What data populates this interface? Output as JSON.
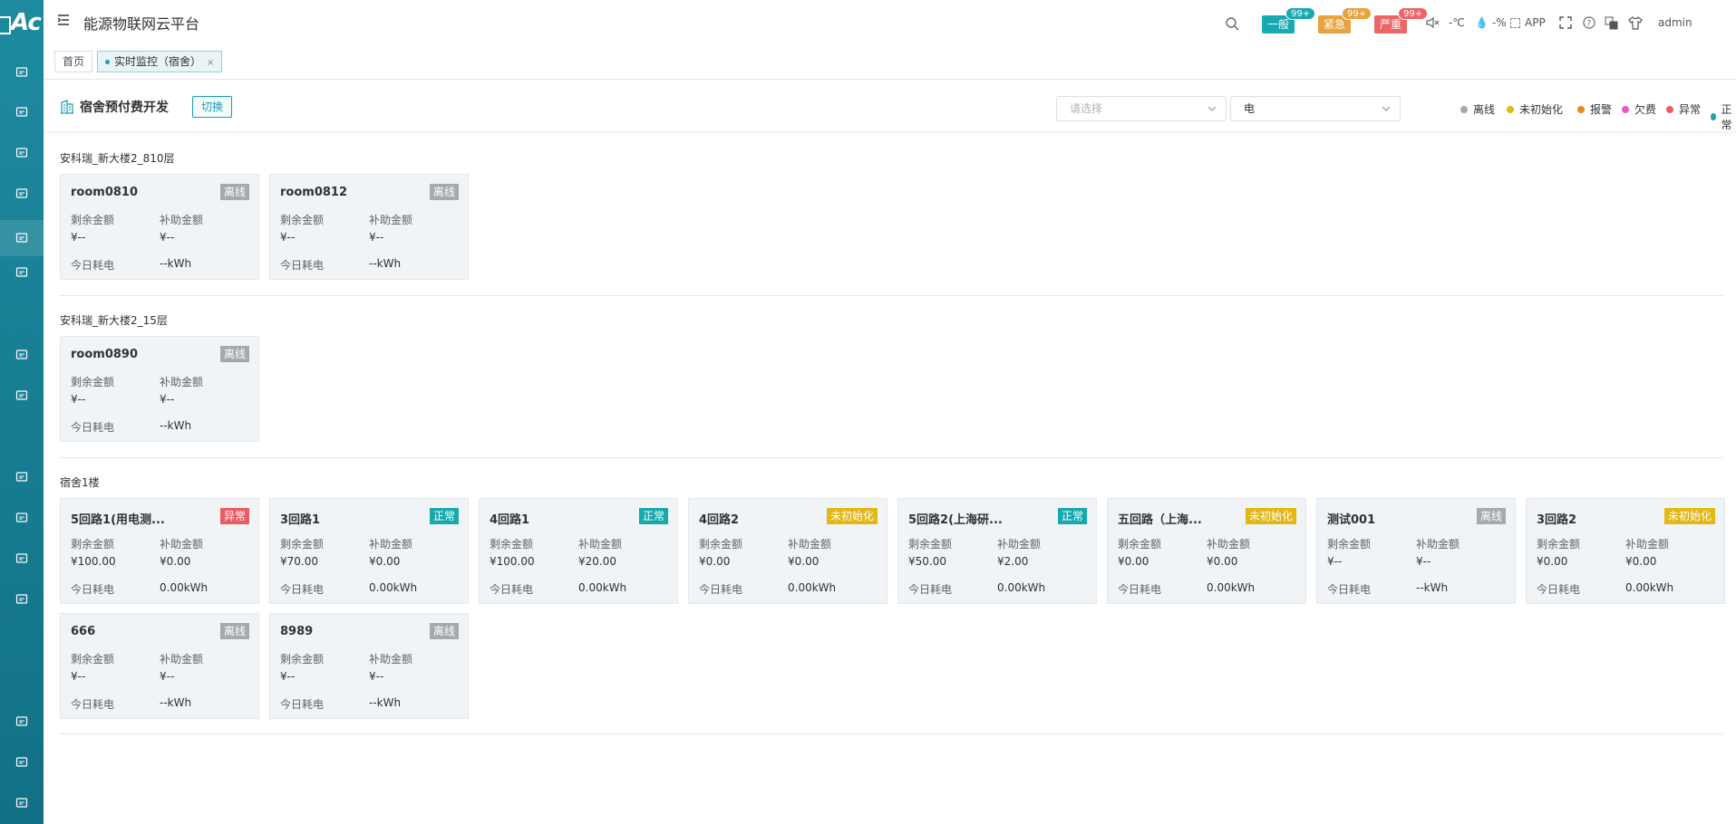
{
  "app": {
    "title": "能源物联网云平台",
    "logo_text": "Ac"
  },
  "sidebar": {
    "icons": [
      "monitor-icon",
      "chart-screen-icon",
      "display-icon",
      "user-group-icon",
      "building-icon",
      "meter-icon",
      "location-icon",
      "camera-icon",
      "flame-icon",
      "thermometer-icon",
      "analysis-icon",
      "screen-icon",
      "report-icon",
      "trend-icon",
      "bar-chart-icon"
    ]
  },
  "top_right": {
    "alarm_general": "一般",
    "alarm_general_badge": "99+",
    "alarm_urgent": "紧急",
    "alarm_urgent_badge": "99+",
    "alarm_serious": "严重",
    "alarm_serious_badge": "99+",
    "temperature": "-℃",
    "humidity": "-%",
    "app_label": "APP",
    "user": "admin",
    "colors": {
      "general": "#19a9b3",
      "urgent": "#e8a23f",
      "serious": "#ec6567"
    }
  },
  "tabs": [
    {
      "label": "首页"
    },
    {
      "label": "实时监控（宿舍）",
      "close": "×"
    }
  ],
  "header": {
    "title": "宿舍预付费开发",
    "switch_label": "切换",
    "select1_placeholder": "请选择",
    "select2_value": "电"
  },
  "legend": [
    {
      "label": "离线",
      "color": "#a6a9ad"
    },
    {
      "label": "未初始化",
      "color": "#e2b814"
    },
    {
      "label": "报警",
      "color": "#e8891a"
    },
    {
      "label": "欠费",
      "color": "#e05ad5"
    },
    {
      "label": "异常",
      "color": "#ea5b63"
    },
    {
      "label": "正常",
      "color": "#17a9ad"
    }
  ],
  "labels": {
    "remaining": "剩余金额",
    "subsidy": "补助金额",
    "today": "今日耗电"
  },
  "groups": [
    {
      "title": "安科瑞_新大楼2_810层",
      "rooms": [
        {
          "name": "room0810",
          "status": "离线",
          "color": "#a6a9ad",
          "remaining": "¥--",
          "subsidy": "¥--",
          "today": "--kWh"
        },
        {
          "name": "room0812",
          "status": "离线",
          "color": "#a6a9ad",
          "remaining": "¥--",
          "subsidy": "¥--",
          "today": "--kWh"
        }
      ]
    },
    {
      "title": "安科瑞_新大楼2_15层",
      "rooms": [
        {
          "name": "room0890",
          "status": "离线",
          "color": "#a6a9ad",
          "remaining": "¥--",
          "subsidy": "¥--",
          "today": "--kWh"
        }
      ]
    },
    {
      "title": "宿舍1楼",
      "rooms": [
        {
          "name": "5回路1(用电测...",
          "status": "异常",
          "color": "#ea5b63",
          "remaining": "¥100.00",
          "subsidy": "¥0.00",
          "today": "0.00kWh"
        },
        {
          "name": "3回路1",
          "status": "正常",
          "color": "#17a9ad",
          "remaining": "¥70.00",
          "subsidy": "¥0.00",
          "today": "0.00kWh"
        },
        {
          "name": "4回路1",
          "status": "正常",
          "color": "#17a9ad",
          "remaining": "¥100.00",
          "subsidy": "¥20.00",
          "today": "0.00kWh"
        },
        {
          "name": "4回路2",
          "status": "未初始化",
          "color": "#e2b814",
          "remaining": "¥0.00",
          "subsidy": "¥0.00",
          "today": "0.00kWh"
        },
        {
          "name": "5回路2(上海研...",
          "status": "正常",
          "color": "#17a9ad",
          "remaining": "¥50.00",
          "subsidy": "¥2.00",
          "today": "0.00kWh"
        },
        {
          "name": "五回路（上海...",
          "status": "未初始化",
          "color": "#e2b814",
          "remaining": "¥0.00",
          "subsidy": "¥0.00",
          "today": "0.00kWh"
        },
        {
          "name": "测试001",
          "status": "离线",
          "color": "#a6a9ad",
          "remaining": "¥--",
          "subsidy": "¥--",
          "today": "--kWh"
        },
        {
          "name": "3回路2",
          "status": "未初始化",
          "color": "#e2b814",
          "remaining": "¥0.00",
          "subsidy": "¥0.00",
          "today": "0.00kWh"
        },
        {
          "name": "666",
          "status": "离线",
          "color": "#a6a9ad",
          "remaining": "¥--",
          "subsidy": "¥--",
          "today": "--kWh"
        },
        {
          "name": "8989",
          "status": "离线",
          "color": "#a6a9ad",
          "remaining": "¥--",
          "subsidy": "¥--",
          "today": "--kWh"
        }
      ]
    }
  ]
}
